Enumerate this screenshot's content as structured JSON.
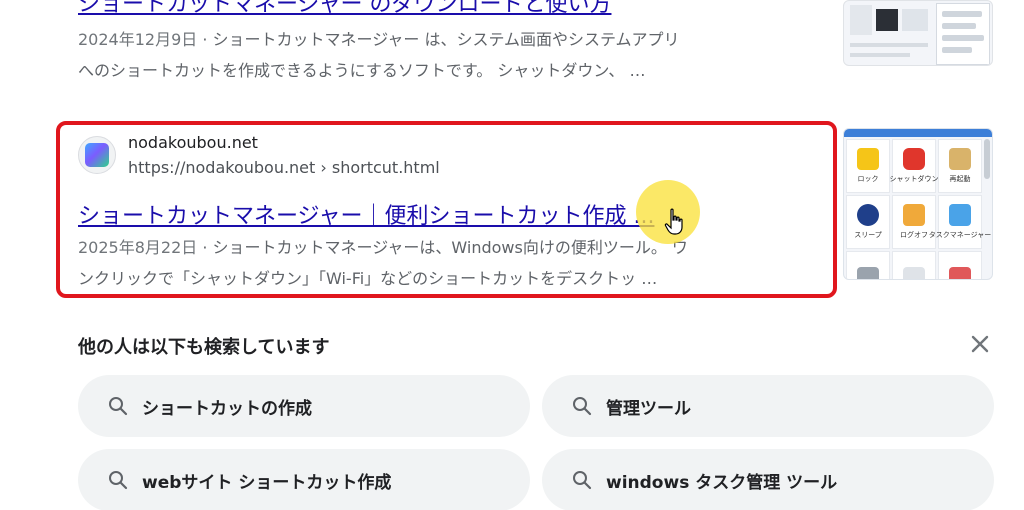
{
  "previous_result": {
    "title": "ショートカットマネージャー のダウンロードと使い方",
    "date": "2024年12月9日",
    "snippet_line1": " · ショートカットマネージャー は、システム画面やシステムアプリ",
    "snippet_line2": "へのショートカットを作成できるようにするソフトです。 シャットダウン、 …"
  },
  "highlighted_result": {
    "site_name": "nodakoubou.net",
    "url": "https://nodakoubou.net › shortcut.html",
    "title": "ショートカットマネージャー｜便利ショートカット作成 ...",
    "date": "2025年8月22日",
    "snippet_line1": " · ショートカットマネージャーは、Windows向けの便利ツール。 ワ",
    "snippet_line2": "ンクリックで「シャットダウン」「Wi-Fi」などのショートカットをデスクトッ …",
    "thumbnail_captions": [
      "ロック",
      "シャットダウン",
      "再起動",
      "スリープ",
      "ログオフ",
      "タスクマネージャー"
    ]
  },
  "related_searches": {
    "header": "他の人は以下も検索しています",
    "items": [
      {
        "label": "ショートカットの作成",
        "icon": "search-icon"
      },
      {
        "label": "管理ツール",
        "icon": "search-icon"
      },
      {
        "label": "webサイト ショートカット作成",
        "icon": "search-icon"
      },
      {
        "label": "windows タスク管理 ツール",
        "icon": "search-icon"
      }
    ]
  },
  "colors": {
    "link": "#1a0dab",
    "highlight_border": "#e0161d",
    "chip_background": "#f1f3f4",
    "cursor_halo": "#fae13c"
  }
}
